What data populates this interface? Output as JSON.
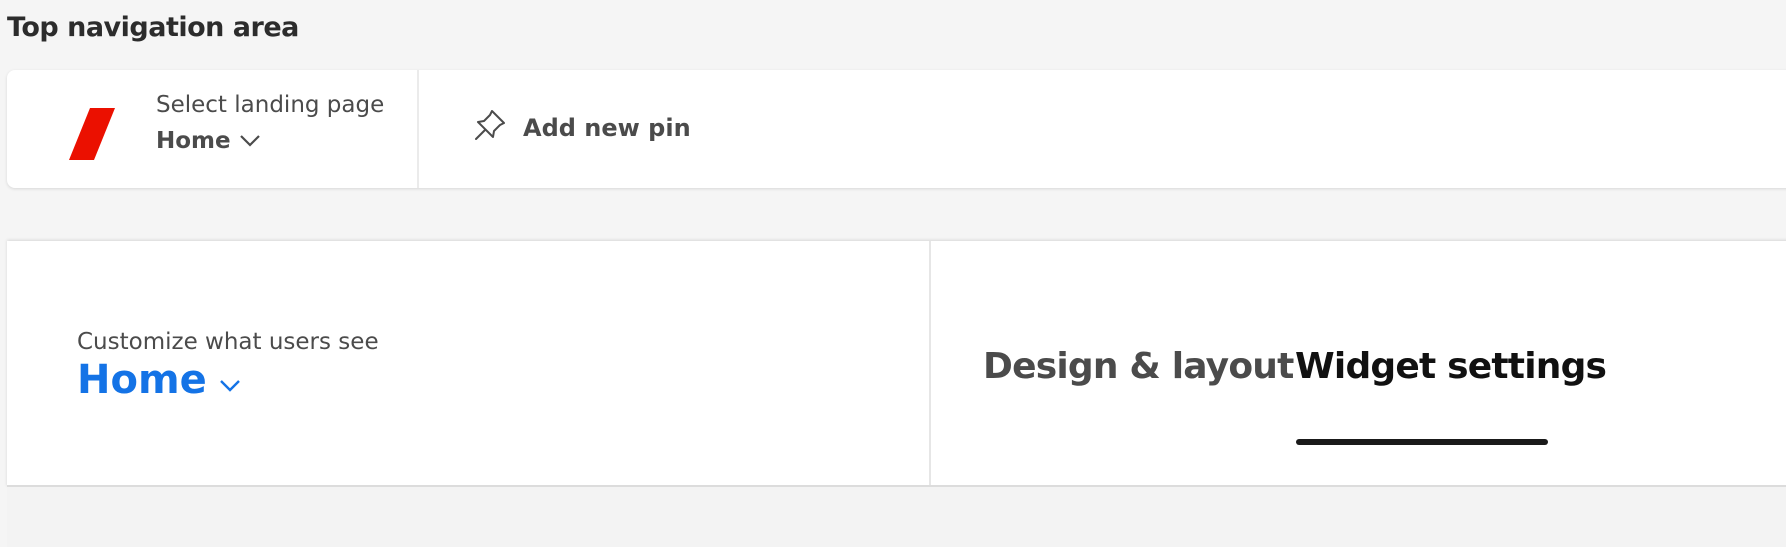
{
  "section_title": "Top navigation area",
  "nav": {
    "landing_label": "Select landing page",
    "landing_value": "Home",
    "add_pin_label": "Add new pin"
  },
  "main": {
    "customize_label": "Customize what users see",
    "customize_value": "Home",
    "tabs": [
      {
        "label": "Design & layout",
        "selected": false
      },
      {
        "label": "Widget settings",
        "selected": true
      }
    ]
  },
  "colors": {
    "brand": "#eb1000",
    "accent": "#1473e6",
    "background": "#f5f5f5"
  },
  "icons": [
    "brand-logo",
    "chevron-down-icon",
    "pin-icon"
  ]
}
